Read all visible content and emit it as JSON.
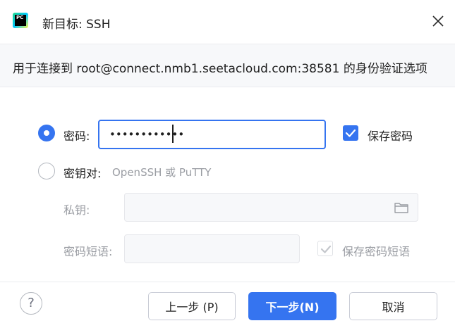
{
  "window": {
    "title": "新目标: SSH",
    "app_icon_text": "PC",
    "close_icon": "close-icon"
  },
  "header": {
    "subtitle": "用于连接到 root@connect.nmb1.seetacloud.com:38581 的身份验证选项"
  },
  "auth": {
    "password_option": {
      "label": "密码:",
      "selected": true,
      "value_masked": "••••••••••••",
      "save_label": "保存密码",
      "save_checked": true
    },
    "keypair_option": {
      "label": "密钥对:",
      "hint": "OpenSSH 或 PuTTY",
      "selected": false,
      "private_key_label": "私钥:",
      "private_key_value": "",
      "folder_icon": "folder-icon",
      "passphrase_label": "密码短语:",
      "passphrase_value": "",
      "save_passphrase_label": "保存密码短语",
      "save_passphrase_checked": true
    }
  },
  "footer": {
    "help_label": "?",
    "back_label": "上一步 (P)",
    "next_label": "下一步(N)",
    "cancel_label": "取消"
  },
  "colors": {
    "accent": "#3574f0",
    "muted_text": "#9a9da3",
    "border": "#dfe1e5"
  }
}
